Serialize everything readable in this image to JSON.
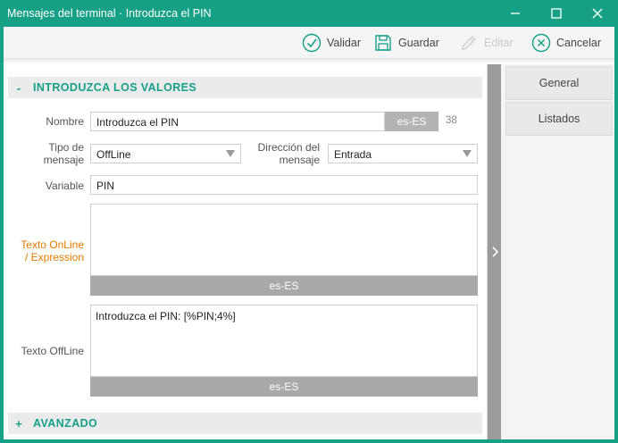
{
  "window": {
    "title": "Mensajes del terminal · Introduzca el PIN"
  },
  "toolbar": {
    "validate_label": "Validar",
    "save_label": "Guardar",
    "edit_label": "Editar",
    "cancel_label": "Cancelar"
  },
  "sections": {
    "values": {
      "sign": "-",
      "title": "INTRODUZCA LOS VALORES"
    },
    "advanced": {
      "sign": "+",
      "title": "AVANZADO"
    }
  },
  "form": {
    "name": {
      "label": "Nombre",
      "value": "Introduzca el PIN",
      "lang": "es-ES",
      "count": "38"
    },
    "message_type": {
      "label_line1": "Tipo de",
      "label_line2": "mensaje",
      "value": "OffLine"
    },
    "direction": {
      "label_line1": "Dirección del",
      "label_line2": "mensaje",
      "value": "Entrada"
    },
    "variable": {
      "label": "Variable",
      "value": "PIN"
    },
    "online_text": {
      "label_line1": "Texto OnLine",
      "label_line2": "/ Expression",
      "value": "",
      "lang": "es-ES"
    },
    "offline_text": {
      "label": "Texto OffLine",
      "value": "Introduzca el PIN: [%PIN;4%]",
      "lang": "es-ES"
    }
  },
  "right_tabs": [
    {
      "label": "General"
    },
    {
      "label": "Listados"
    }
  ],
  "colors": {
    "accent": "#16a085",
    "highlight_label": "#e07b00",
    "lang_tag": "#b3b3b3"
  },
  "icons": {
    "validate": "check-circle-icon",
    "save": "floppy-disk-icon",
    "edit": "pencil-icon",
    "cancel": "x-circle-icon",
    "splitter": "chevron-right-icon"
  }
}
